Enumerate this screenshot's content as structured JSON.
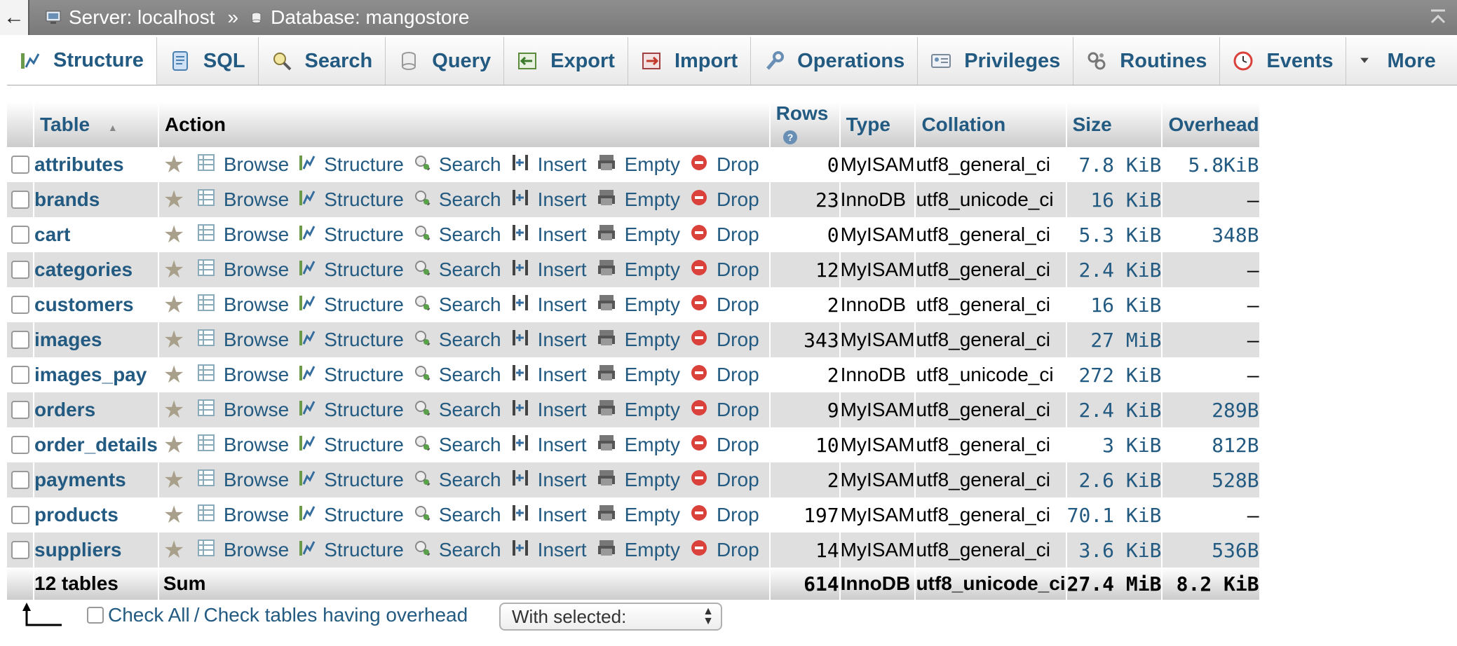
{
  "breadcrumb": {
    "back": "←",
    "server_label": "Server: localhost",
    "separator": "»",
    "database_label": "Database: mangostore"
  },
  "tabs": [
    {
      "label": "Structure",
      "icon": "structure-icon",
      "active": true
    },
    {
      "label": "SQL",
      "icon": "sql-icon"
    },
    {
      "label": "Search",
      "icon": "search-icon"
    },
    {
      "label": "Query",
      "icon": "query-icon"
    },
    {
      "label": "Export",
      "icon": "export-icon"
    },
    {
      "label": "Import",
      "icon": "import-icon"
    },
    {
      "label": "Operations",
      "icon": "wrench-icon"
    },
    {
      "label": "Privileges",
      "icon": "privileges-icon"
    },
    {
      "label": "Routines",
      "icon": "routines-icon"
    },
    {
      "label": "Events",
      "icon": "clock-icon"
    },
    {
      "label": "More",
      "icon": "triangle-down-icon"
    }
  ],
  "table": {
    "headers": {
      "table": "Table",
      "action": "Action",
      "rows": "Rows",
      "type": "Type",
      "collation": "Collation",
      "size": "Size",
      "overhead": "Overhead"
    },
    "action_labels": {
      "browse": "Browse",
      "structure": "Structure",
      "search": "Search",
      "insert": "Insert",
      "empty": "Empty",
      "drop": "Drop"
    },
    "rows": [
      {
        "name": "attributes",
        "rows": "0",
        "type": "MyISAM",
        "collation": "utf8_general_ci",
        "size": "7.8 KiB",
        "overhead": "5.8KiB"
      },
      {
        "name": "brands",
        "rows": "23",
        "type": "InnoDB",
        "collation": "utf8_unicode_ci",
        "size": "16 KiB",
        "overhead": "–"
      },
      {
        "name": "cart",
        "rows": "0",
        "type": "MyISAM",
        "collation": "utf8_general_ci",
        "size": "5.3 KiB",
        "overhead": "348B"
      },
      {
        "name": "categories",
        "rows": "12",
        "type": "MyISAM",
        "collation": "utf8_general_ci",
        "size": "2.4 KiB",
        "overhead": "–"
      },
      {
        "name": "customers",
        "rows": "2",
        "type": "InnoDB",
        "collation": "utf8_general_ci",
        "size": "16 KiB",
        "overhead": "–"
      },
      {
        "name": "images",
        "rows": "343",
        "type": "MyISAM",
        "collation": "utf8_general_ci",
        "size": "27 MiB",
        "overhead": "–"
      },
      {
        "name": "images_pay",
        "rows": "2",
        "type": "InnoDB",
        "collation": "utf8_unicode_ci",
        "size": "272 KiB",
        "overhead": "–"
      },
      {
        "name": "orders",
        "rows": "9",
        "type": "MyISAM",
        "collation": "utf8_general_ci",
        "size": "2.4 KiB",
        "overhead": "289B"
      },
      {
        "name": "order_details",
        "rows": "10",
        "type": "MyISAM",
        "collation": "utf8_general_ci",
        "size": "3 KiB",
        "overhead": "812B"
      },
      {
        "name": "payments",
        "rows": "2",
        "type": "MyISAM",
        "collation": "utf8_general_ci",
        "size": "2.6 KiB",
        "overhead": "528B"
      },
      {
        "name": "products",
        "rows": "197",
        "type": "MyISAM",
        "collation": "utf8_general_ci",
        "size": "70.1 KiB",
        "overhead": "–"
      },
      {
        "name": "suppliers",
        "rows": "14",
        "type": "MyISAM",
        "collation": "utf8_general_ci",
        "size": "3.6 KiB",
        "overhead": "536B"
      }
    ],
    "footer": {
      "count": "12 tables",
      "sum": "Sum",
      "rows": "614",
      "type": "InnoDB",
      "collation": "utf8_unicode_ci",
      "size": "27.4 MiB",
      "overhead": "8.2 KiB"
    }
  },
  "controls": {
    "check_all": "Check All",
    "slash": "/",
    "check_overhead": "Check tables having overhead",
    "with_selected": "With selected:"
  },
  "colors": {
    "link": "#235a81",
    "topbar": "#858585",
    "row_alt": "#dfdfdf",
    "drop_red": "#d9413a"
  }
}
